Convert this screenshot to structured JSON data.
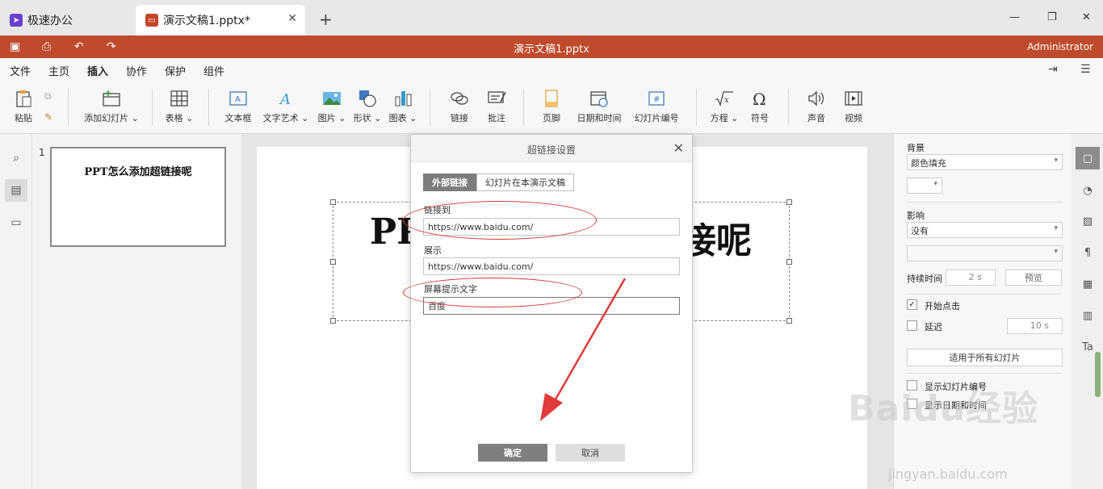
{
  "tabs": {
    "home_label": "极速办公",
    "doc_label": "演示文稿1.pptx*"
  },
  "titlebar": {
    "title": "演示文稿1.pptx",
    "user": "Administrator"
  },
  "menu": {
    "items": [
      "文件",
      "主页",
      "插入",
      "协作",
      "保护",
      "组件"
    ],
    "active": "插入"
  },
  "ribbon": {
    "paste": "粘贴",
    "add_slide": "添加幻灯片 ⌄",
    "table": "表格 ⌄",
    "textbox": "文本框",
    "textart": "文字艺术 ⌄",
    "image": "图片 ⌄",
    "shape": "形状 ⌄",
    "chart": "图表 ⌄",
    "link": "链接",
    "comment": "批注",
    "footer": "页脚",
    "datetime": "日期和时间",
    "slide_number": "幻灯片编号",
    "equation": "方程 ⌄",
    "symbol": "符号",
    "audio": "声音",
    "video": "视频"
  },
  "thumbnails": {
    "number": "1",
    "title": "PPT怎么添加超链接呢"
  },
  "slide": {
    "title_left": "PP",
    "title_right": "接呢"
  },
  "dialog": {
    "title": "超链接设置",
    "tab_external": "外部链接",
    "tab_internal": "幻灯片在本演示文稿",
    "link_label": "链接到",
    "link_value": "https://www.baidu.com/",
    "display_label": "展示",
    "display_value": "https://www.baidu.com/",
    "tooltip_label": "屏幕提示文字",
    "tooltip_value": "百度",
    "ok": "确定",
    "cancel": "取消"
  },
  "properties": {
    "background_label": "背景",
    "background_value": "颜色填充",
    "effect_label": "影响",
    "effect_value": "没有",
    "duration_label": "持续时间",
    "duration_value": "2 s",
    "preview": "预览",
    "on_click": "开始点击",
    "delay": "延迟",
    "delay_value": "10 s",
    "apply_all": "适用于所有幻灯片",
    "show_number": "显示幻灯片编号",
    "show_datetime": "显示日期和时间"
  },
  "watermark": {
    "text": "Baidu经验",
    "sub": "jingyan.baidu.com"
  },
  "colors": {
    "accent": "#bf4a2c",
    "annotation": "#d83a3a"
  }
}
